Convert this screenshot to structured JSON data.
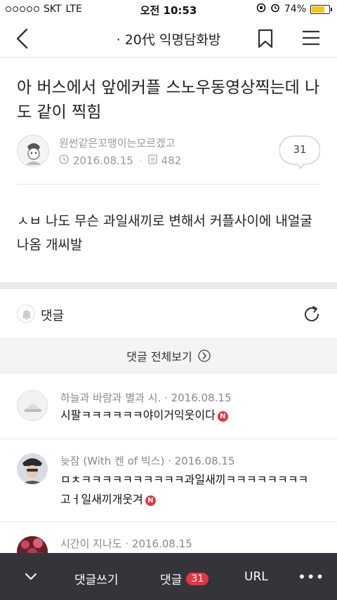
{
  "status_bar": {
    "carrier": "SKT",
    "network": "LTE",
    "time": "오전 10:53",
    "battery": "74%",
    "battery_level": 0.74
  },
  "nav": {
    "title": "· 20代 익명담화방"
  },
  "post": {
    "title": "아 버스에서 앞에커플 스노우동영상찍는데 나도 같이 찍힘",
    "author": "원썬같은꼬맹이는모르겠고",
    "date": "2016.08.15",
    "views": "482",
    "comment_count": "31",
    "body": "ㅅㅂ 나도 무슨 과일새끼로 변해서 커플사이에 내얼굴 나옴 개씨발"
  },
  "comments_section": {
    "label": "댓글",
    "view_all": "댓글 전체보기"
  },
  "comments": [
    {
      "author": "하늘과 바람과 별과 시.",
      "date": "2016.08.15",
      "text": "시팔ㅋㅋㅋㅋㅋㅋ야이거익웃이다",
      "badge": "N"
    },
    {
      "author": "늦잠 (With 켄 of 빅스)",
      "date": "2016.08.15",
      "text": "ㅁㅊㅋㅋㅋㅋㅋㅋㅋㅋㅋㅋ과일새끼ㅋㅋㅋㅋㅋㅋㅋㅋ고ㅓ일새끼개웃겨",
      "badge": "N"
    },
    {
      "author": "시간이 지나도",
      "date": "2016.08.15",
      "text": "",
      "badge": ""
    }
  ],
  "bottom_bar": {
    "write_label": "댓글쓰기",
    "comments_label": "댓글",
    "comments_count": "31",
    "url_label": "URL",
    "more_label": "•••"
  },
  "colors": {
    "accent_red": "#e8343f",
    "bottom_bar": "#34353b",
    "battery": "#f5c518",
    "muted_text": "#999999"
  }
}
